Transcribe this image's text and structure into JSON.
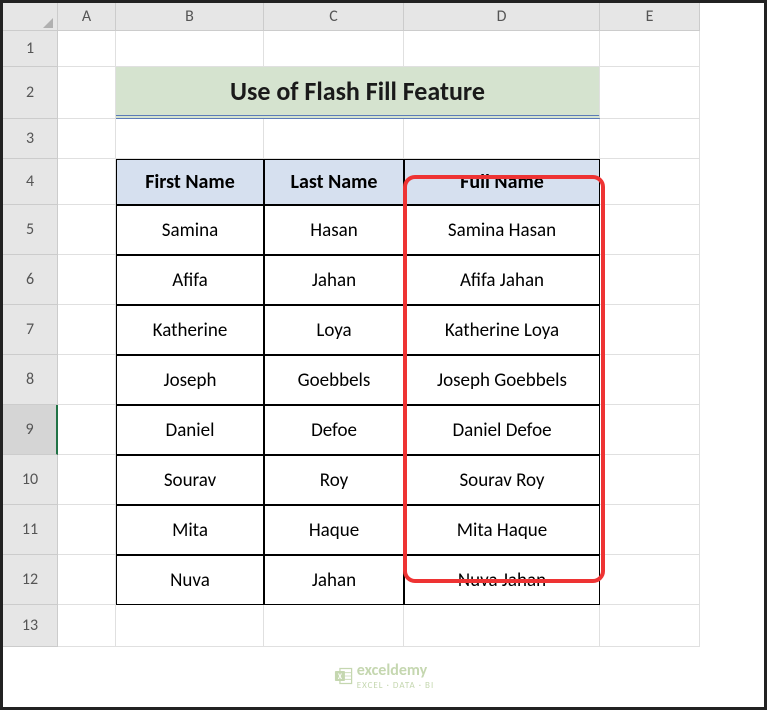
{
  "columns": [
    "A",
    "B",
    "C",
    "D",
    "E"
  ],
  "rows": [
    "1",
    "2",
    "3",
    "4",
    "5",
    "6",
    "7",
    "8",
    "9",
    "10",
    "11",
    "12",
    "13"
  ],
  "active_row": "9",
  "title": "Use of Flash Fill Feature",
  "headers": {
    "b": "First Name",
    "c": "Last Name",
    "d": "Full Name"
  },
  "data": [
    {
      "first": "Samina",
      "last": "Hasan",
      "full": "Samina Hasan"
    },
    {
      "first": "Afifa",
      "last": "Jahan",
      "full": "Afifa Jahan"
    },
    {
      "first": "Katherine",
      "last": "Loya",
      "full": "Katherine Loya"
    },
    {
      "first": "Joseph",
      "last": "Goebbels",
      "full": "Joseph Goebbels"
    },
    {
      "first": "Daniel",
      "last": "Defoe",
      "full": "Daniel Defoe"
    },
    {
      "first": "Sourav",
      "last": "Roy",
      "full": "Sourav Roy"
    },
    {
      "first": "Mita",
      "last": "Haque",
      "full": "Mita Haque"
    },
    {
      "first": "Nuva",
      "last": "Jahan",
      "full": "Nuva Jahan"
    }
  ],
  "watermark": {
    "brand": "exceldemy",
    "tagline": "EXCEL · DATA · BI"
  }
}
